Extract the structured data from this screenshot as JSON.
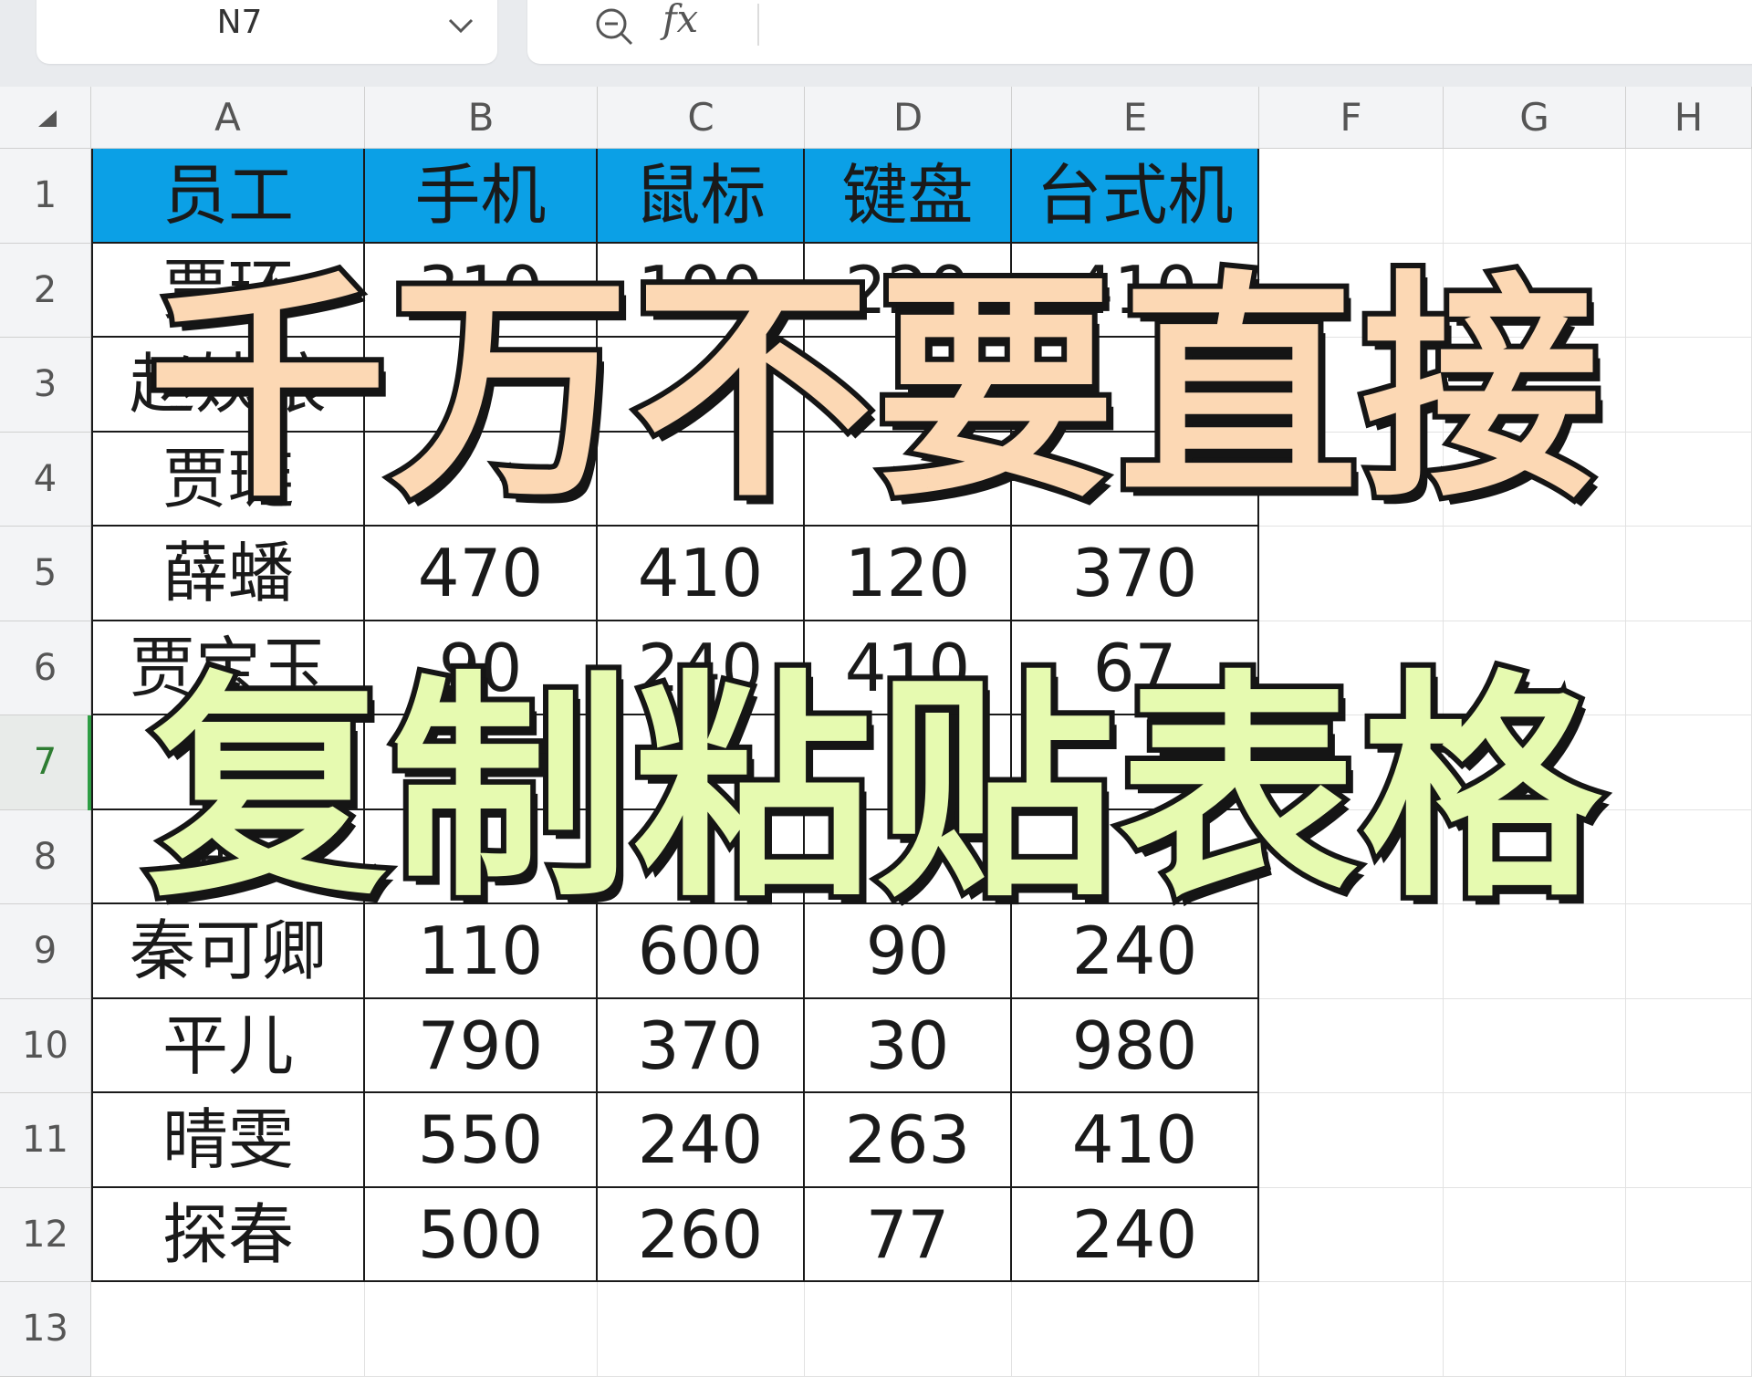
{
  "namebox": {
    "cell_ref": "N7"
  },
  "formula_bar": {
    "fx_label": "fx"
  },
  "columns": [
    "A",
    "B",
    "C",
    "D",
    "E",
    "F",
    "G",
    "H"
  ],
  "rows": [
    "1",
    "2",
    "3",
    "4",
    "5",
    "6",
    "7",
    "8",
    "9",
    "10",
    "11",
    "12",
    "13"
  ],
  "active_row": "7",
  "table": {
    "headers": [
      "员工",
      "手机",
      "鼠标",
      "键盘",
      "台式机"
    ],
    "rows": [
      [
        "贾环",
        "310",
        "100",
        "220",
        "410"
      ],
      [
        "赵姨娘",
        "",
        "",
        "",
        ""
      ],
      [
        "贾琏",
        "",
        "",
        "",
        ""
      ],
      [
        "薛蟠",
        "470",
        "410",
        "120",
        "370"
      ],
      [
        "贾宝玉",
        "90",
        "240",
        "410",
        "67"
      ],
      [
        "林",
        "",
        "",
        "",
        ""
      ],
      [
        "薛",
        "",
        "",
        "",
        ""
      ],
      [
        "秦可卿",
        "110",
        "600",
        "90",
        "240"
      ],
      [
        "平儿",
        "790",
        "370",
        "30",
        "980"
      ],
      [
        "晴雯",
        "550",
        "240",
        "263",
        "410"
      ],
      [
        "探春",
        "500",
        "260",
        "77",
        "240"
      ]
    ]
  },
  "overlay": {
    "line1": "千万不要直接",
    "line2": "复制粘贴表格"
  },
  "colors": {
    "header_fill": "#0ba0e6",
    "overlay_line1": "#fcd8b4",
    "overlay_line2": "#e6fab0",
    "active_indicator": "#2e9e44"
  }
}
